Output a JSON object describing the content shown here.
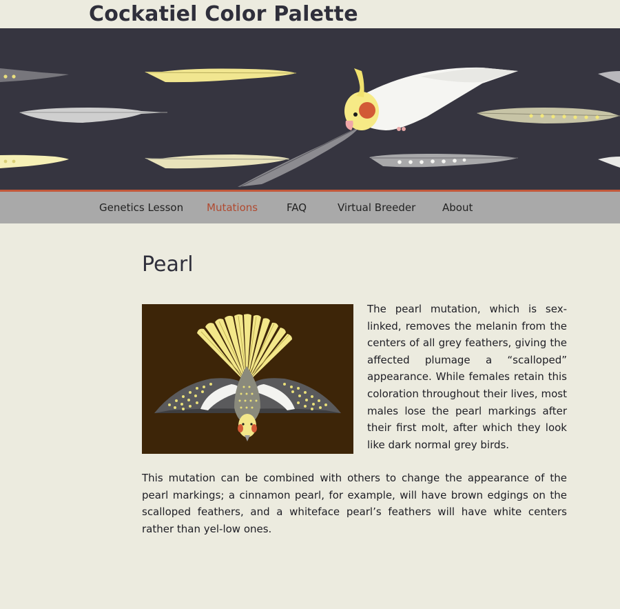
{
  "site": {
    "title": "Cockatiel Color Palette"
  },
  "nav": {
    "items": [
      {
        "label": "Genetics Lesson",
        "active": false
      },
      {
        "label": "Mutations",
        "active": true
      },
      {
        "label": "FAQ",
        "active": false
      },
      {
        "label": "Virtual Breeder",
        "active": false
      },
      {
        "label": "About",
        "active": false
      }
    ]
  },
  "article": {
    "heading": "Pearl",
    "paragraphs": [
      "The pearl mutation, which is sex-linked, removes the melanin from the centers of all grey feathers, giving the affected plumage a “scalloped” appearance. While females retain this coloration throughout their lives, most males lose the pearl markings after their first molt, after which they look like dark normal grey birds.",
      "This mutation can be combined with others to change the appearance of the pearl markings; a cinnamon pearl, for example, will have brown edgings on the scalloped feathers, and a whiteface pearl’s feathers will have white centers rather than yel-low ones."
    ]
  },
  "colors": {
    "background": "#ecebdf",
    "banner": "#363540",
    "accent_rule": "#c3583a",
    "nav_bg": "#a9a9a9",
    "nav_active": "#b04a30",
    "figure_bg": "#3d2508",
    "pearl_yellow": "#f3e78a"
  },
  "icons": {
    "banner": "cockatiel-with-feathers-illustration",
    "figure": "pearl-cockatiel-spread-wings-illustration"
  }
}
